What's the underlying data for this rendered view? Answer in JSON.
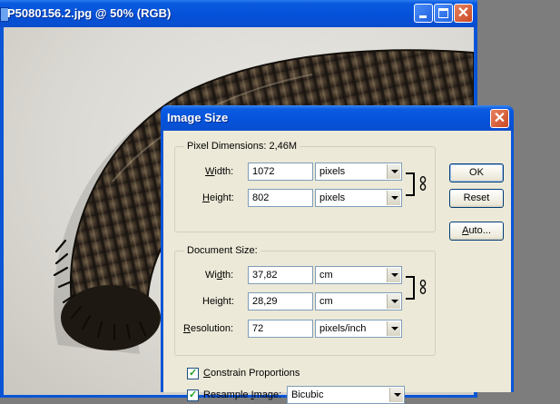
{
  "document_window": {
    "title": "P5080156.2.jpg @ 50% (RGB)",
    "buttons": [
      "minimize",
      "maximize",
      "close"
    ]
  },
  "dialog": {
    "title": "Image Size",
    "pixel_dimensions": {
      "label": "Pixel Dimensions:",
      "size": "2,46M",
      "width_label": "Width:",
      "width_value": "1072",
      "width_unit": "pixels",
      "height_label": "Height:",
      "height_value": "802",
      "height_unit": "pixels"
    },
    "document_size": {
      "label": "Document Size:",
      "width_label": "Width:",
      "width_value": "37,82",
      "width_unit": "cm",
      "height_label": "Height:",
      "height_value": "28,29",
      "height_unit": "cm",
      "resolution_label": "Resolution:",
      "resolution_value": "72",
      "resolution_unit": "pixels/inch"
    },
    "constrain_proportions": {
      "label": "Constrain Proportions",
      "checked": true
    },
    "resample_image": {
      "label": "Resample Image:",
      "checked": true,
      "method": "Bicubic"
    },
    "buttons": {
      "ok": "OK",
      "reset": "Reset",
      "auto": "Auto..."
    }
  },
  "colors": {
    "titlebar_blue": "#0a55d6",
    "dialog_face": "#ece9d8",
    "close_button_red": "#c94a25",
    "input_border": "#7f9db9"
  }
}
